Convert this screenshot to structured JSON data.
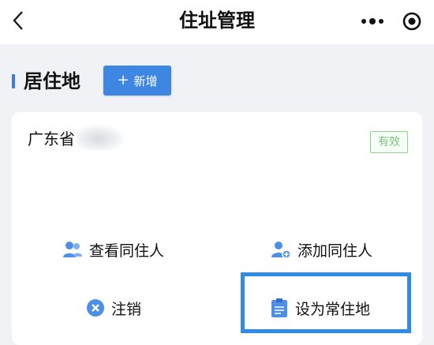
{
  "header": {
    "title": "住址管理",
    "back_icon": "chevron-left-icon",
    "more_icon": "more-dots-icon",
    "target_icon": "target-icon"
  },
  "section": {
    "title": "居住地",
    "add_button_label": "新增",
    "accent_color": "#3d87e3"
  },
  "address_card": {
    "address_prefix": "广东省",
    "status": "有效",
    "actions": [
      {
        "label": "查看同住人",
        "icon": "people-icon"
      },
      {
        "label": "添加同住人",
        "icon": "add-person-icon"
      },
      {
        "label": "注销",
        "icon": "cancel-circle-icon"
      },
      {
        "label": "设为常住地",
        "icon": "clipboard-icon"
      }
    ]
  },
  "colors": {
    "highlight_border": "#2f8ce6",
    "status_green": "#7fc07f",
    "icon_blue": "#4d8fe6"
  }
}
